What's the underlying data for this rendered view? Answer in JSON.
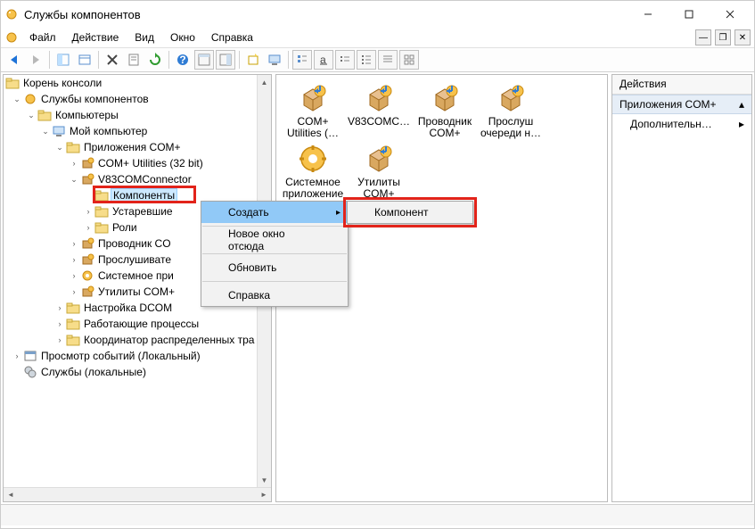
{
  "title": "Службы компонентов",
  "menu": {
    "file": "Файл",
    "action": "Действие",
    "view": "Вид",
    "window": "Окно",
    "help": "Справка"
  },
  "tree": {
    "root": "Корень консоли",
    "services": "Службы компонентов",
    "computers": "Компьютеры",
    "my_computer": "Мой компьютер",
    "com_apps": "Приложения COM+",
    "com_utils_32": "COM+ Utilities (32 bit)",
    "v83": "V83COMConnector",
    "components": "Компоненты",
    "legacy": "Устаревшие",
    "roles": "Роли",
    "explorer_com": "Проводник CO",
    "listener": "Прослушивате",
    "system_app": "Системное при",
    "com_utilities": "Утилиты COM+",
    "dcom": "Настройка DCOM",
    "processes": "Работающие процессы",
    "coordinator": "Координатор распределенных тра",
    "event_viewer": "Просмотр событий (Локальный)",
    "local_services": "Службы (локальные)"
  },
  "listview": {
    "items": [
      {
        "label": "COM+ Utilities (…",
        "icon": "box"
      },
      {
        "label": "V83COMC…",
        "icon": "box"
      },
      {
        "label": "Проводник COM+",
        "icon": "box"
      },
      {
        "label": "Прослуш очереди н…",
        "icon": "box"
      },
      {
        "label": "Системное приложение",
        "icon": "gear"
      },
      {
        "label": "Утилиты COM+",
        "icon": "box"
      }
    ]
  },
  "context_menu": {
    "create": "Создать",
    "new_window": "Новое окно отсюда",
    "refresh": "Обновить",
    "help": "Справка",
    "submenu_component": "Компонент"
  },
  "actions": {
    "header": "Действия",
    "band": "Приложения COM+",
    "more": "Дополнительн…"
  }
}
